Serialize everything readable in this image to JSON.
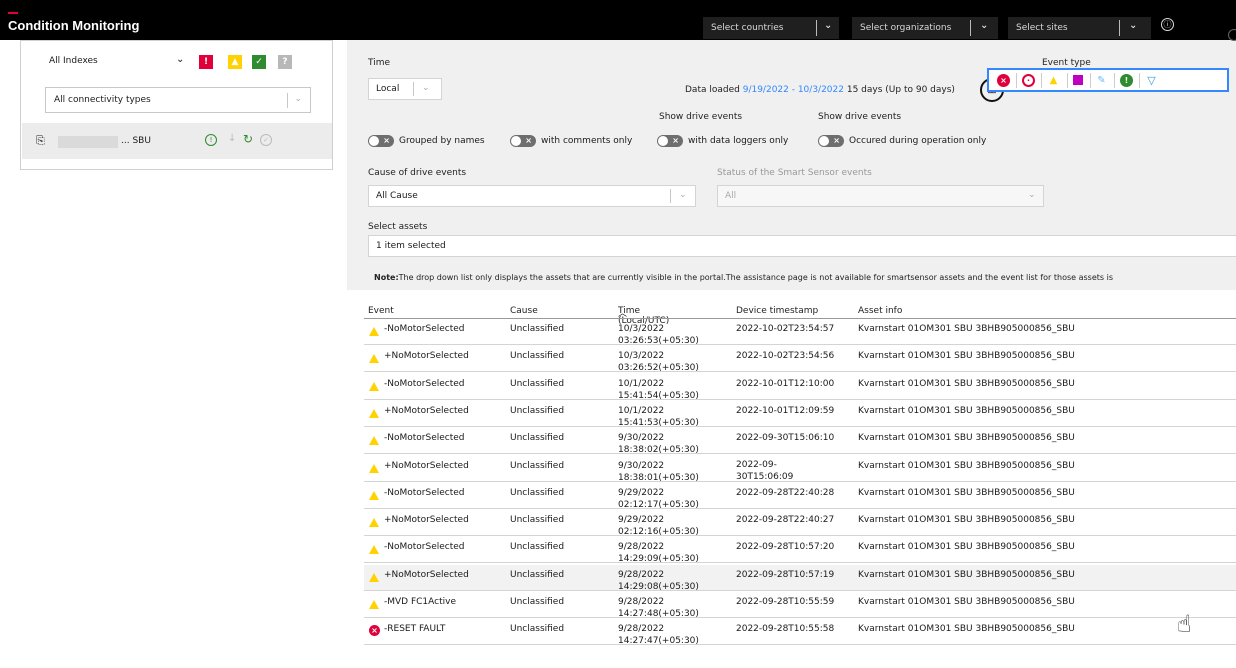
{
  "header": {
    "title": "Condition Monitoring",
    "countries_placeholder": "Select countries",
    "organizations_placeholder": "Select organizations",
    "sites_placeholder": "Select sites",
    "info_glyph": "ⓘ"
  },
  "left": {
    "index_label": "All Indexes",
    "connectivity": "All connectivity types",
    "indicators": [
      "!",
      "▲",
      "✓",
      "?"
    ],
    "asset_name": "... SBU"
  },
  "filters": {
    "time_label": "Time",
    "time_value": "Local",
    "data_loaded_prefix": "Data loaded",
    "data_loaded_range": "9/19/2022 - 10/3/2022",
    "data_loaded_suffix": "15 days (Up to 90 days)",
    "event_type_label": "Event type",
    "show_drive_events_1": "Show drive events",
    "show_drive_events_2": "Show drive events",
    "toggle_grouped": "Grouped by names",
    "toggle_comments": "with comments only",
    "toggle_loggers": "with data loggers only",
    "toggle_operation": "Occured during operation only",
    "cause_label": "Cause of drive events",
    "cause_value": "All Cause",
    "smart_label": "Status of the Smart Sensor events",
    "smart_value": "All",
    "assets_label": "Select assets",
    "assets_value": "1 item selected",
    "note_bold": "Note:",
    "note_text": "The drop down list only displays the assets that are currently visible in the portal.The assistance page is not available for smartsensor assets and the event list for those assets is"
  },
  "table": {
    "columns": [
      "Event",
      "Cause",
      "Time (Local/UTC)",
      "Device timestamp",
      "Asset info"
    ],
    "sort_glyph": "︿",
    "rows": [
      {
        "event": "-NoMotorSelected",
        "cause": "Unclassified",
        "date": "10/3/2022",
        "time": "03:26:53(+05:30)",
        "device": "2022-10-02T23:54:57",
        "device2": "",
        "asset": "Kvarnstart 01OM301 SBU 3BHB905000856_SBU",
        "level": "warning"
      },
      {
        "event": "+NoMotorSelected",
        "cause": "Unclassified",
        "date": "10/3/2022",
        "time": "03:26:52(+05:30)",
        "device": "2022-10-02T23:54:56",
        "device2": "",
        "asset": "Kvarnstart 01OM301 SBU 3BHB905000856_SBU",
        "level": "warning"
      },
      {
        "event": "-NoMotorSelected",
        "cause": "Unclassified",
        "date": "10/1/2022",
        "time": "15:41:54(+05:30)",
        "device": "2022-10-01T12:10:00",
        "device2": "",
        "asset": "Kvarnstart 01OM301 SBU 3BHB905000856_SBU",
        "level": "warning"
      },
      {
        "event": "+NoMotorSelected",
        "cause": "Unclassified",
        "date": "10/1/2022",
        "time": "15:41:53(+05:30)",
        "device": "2022-10-01T12:09:59",
        "device2": "",
        "asset": "Kvarnstart 01OM301 SBU 3BHB905000856_SBU",
        "level": "warning"
      },
      {
        "event": "-NoMotorSelected",
        "cause": "Unclassified",
        "date": "9/30/2022",
        "time": "18:38:02(+05:30)",
        "device": "2022-09-30T15:06:10",
        "device2": "",
        "asset": "Kvarnstart 01OM301 SBU 3BHB905000856_SBU",
        "level": "warning"
      },
      {
        "event": "+NoMotorSelected",
        "cause": "Unclassified",
        "date": "9/30/2022",
        "time": "18:38:01(+05:30)",
        "device": "2022-09-",
        "device2": "30T15:06:09",
        "asset": "Kvarnstart 01OM301 SBU 3BHB905000856_SBU",
        "level": "warning"
      },
      {
        "event": "-NoMotorSelected",
        "cause": "Unclassified",
        "date": "9/29/2022",
        "time": "02:12:17(+05:30)",
        "device": "2022-09-28T22:40:28",
        "device2": "",
        "asset": "Kvarnstart 01OM301 SBU 3BHB905000856_SBU",
        "level": "warning"
      },
      {
        "event": "+NoMotorSelected",
        "cause": "Unclassified",
        "date": "9/29/2022",
        "time": "02:12:16(+05:30)",
        "device": "2022-09-28T22:40:27",
        "device2": "",
        "asset": "Kvarnstart 01OM301 SBU 3BHB905000856_SBU",
        "level": "warning"
      },
      {
        "event": "-NoMotorSelected",
        "cause": "Unclassified",
        "date": "9/28/2022",
        "time": "14:29:09(+05:30)",
        "device": "2022-09-28T10:57:20",
        "device2": "",
        "asset": "Kvarnstart 01OM301 SBU 3BHB905000856_SBU",
        "level": "warning"
      },
      {
        "event": "+NoMotorSelected",
        "cause": "Unclassified",
        "date": "9/28/2022",
        "time": "14:29:08(+05:30)",
        "device": "2022-09-28T10:57:19",
        "device2": "",
        "asset": "Kvarnstart 01OM301 SBU 3BHB905000856_SBU",
        "level": "warning"
      },
      {
        "event": "-MVD FC1Active",
        "cause": "Unclassified",
        "date": "9/28/2022",
        "time": "14:27:48(+05:30)",
        "device": "2022-09-28T10:55:59",
        "device2": "",
        "asset": "Kvarnstart 01OM301 SBU 3BHB905000856_SBU",
        "level": "warning"
      },
      {
        "event": "-RESET FAULT",
        "cause": "Unclassified",
        "date": "9/28/2022",
        "time": "14:27:47(+05:30)",
        "device": "2022-09-28T10:55:58",
        "device2": "",
        "asset": "Kvarnstart 01OM301 SBU 3BHB905000856_SBU",
        "level": "fault"
      }
    ]
  },
  "colors": {
    "fault": "#e0003c",
    "warning": "#ffd200",
    "ok": "#2e8b2e",
    "unknown": "#9a9a9a",
    "link": "#3388ff",
    "accent_purple": "#c000c0",
    "accent_blue": "#66bbff"
  }
}
